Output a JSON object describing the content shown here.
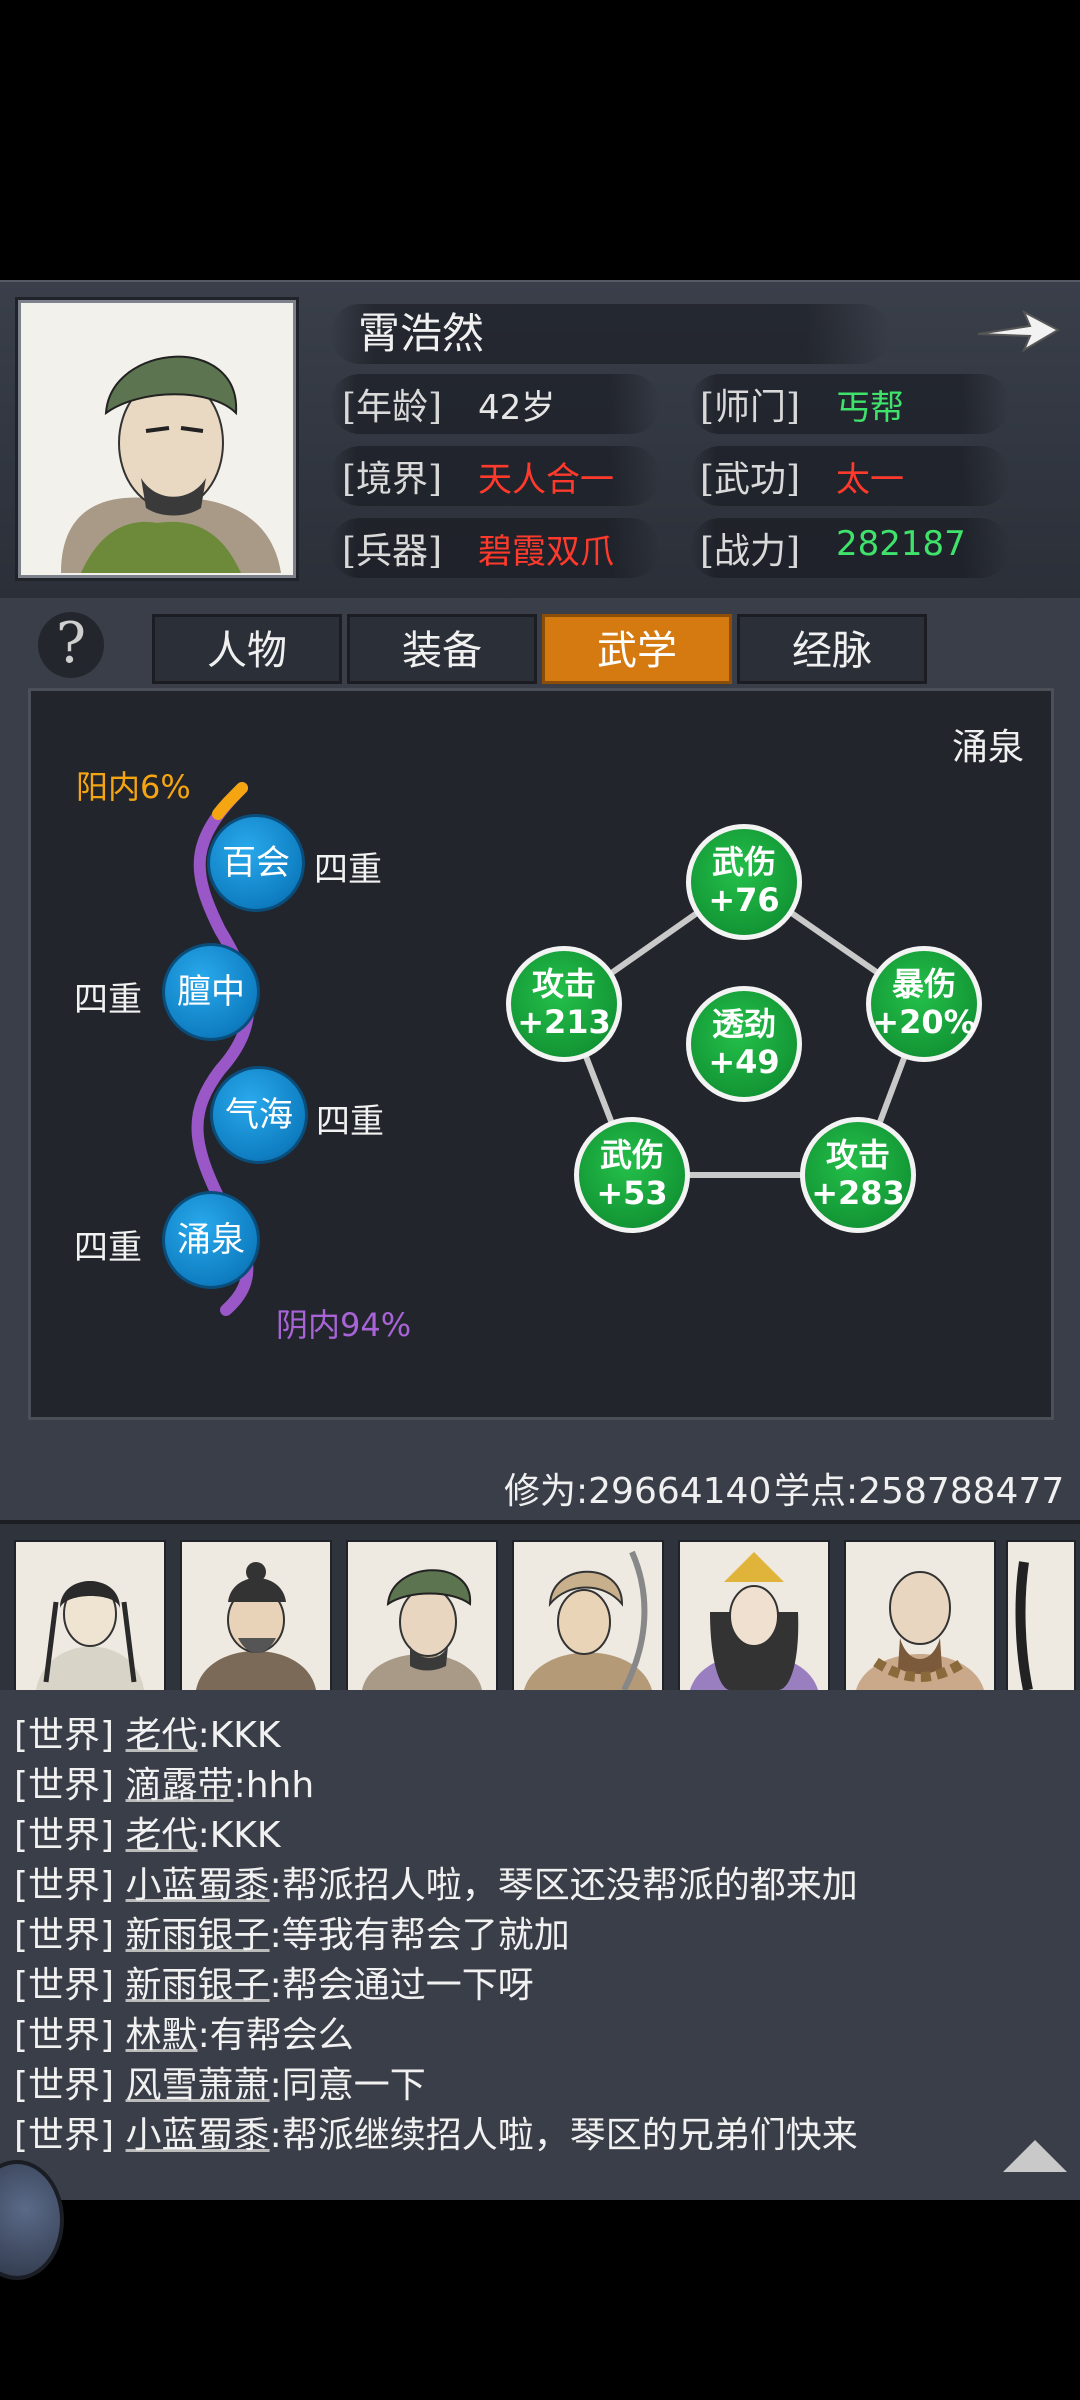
{
  "profile": {
    "name": "霄浩然",
    "stats": [
      {
        "label": "[年龄]",
        "value": "42岁",
        "color": "#e6e6e6"
      },
      {
        "label": "[师门]",
        "value": "丐帮",
        "color": "#3fe36b"
      },
      {
        "label": "[境界]",
        "value": "天人合一",
        "color": "#ff3a2c"
      },
      {
        "label": "[武功]",
        "value": "太一",
        "color": "#ff3a2c"
      },
      {
        "label": "[兵器]",
        "value": "碧霞双爪",
        "color": "#ff3a2c"
      },
      {
        "label": "[战力]",
        "value": "282187",
        "color": "#3fe36b"
      }
    ]
  },
  "tabs": [
    "人物",
    "装备",
    "武学",
    "经脉"
  ],
  "active_tab": "武学",
  "help_label": "?",
  "meridian": {
    "selected": "涌泉",
    "yang_label": "阳内6%",
    "yin_label": "阴内94%",
    "acupoints": [
      {
        "name": "百会",
        "level": "四重"
      },
      {
        "name": "膻中",
        "level": "四重"
      },
      {
        "name": "气海",
        "level": "四重"
      },
      {
        "name": "涌泉",
        "level": "四重"
      }
    ],
    "bonuses": [
      {
        "name": "武伤",
        "value": "+76"
      },
      {
        "name": "暴伤",
        "value": "+20%"
      },
      {
        "name": "攻击",
        "value": "+283"
      },
      {
        "name": "武伤",
        "value": "+53"
      },
      {
        "name": "攻击",
        "value": "+213"
      },
      {
        "name": "透劲",
        "value": "+49"
      }
    ]
  },
  "progress": {
    "cultivation": "修为:29664140",
    "points": "学点:258788477"
  },
  "chat": [
    {
      "channel": "[世界]",
      "name": "老代",
      "msg": ":KKK"
    },
    {
      "channel": "[世界]",
      "name": "滴露带",
      "msg": ":hhh"
    },
    {
      "channel": "[世界]",
      "name": "老代",
      "msg": ":KKK"
    },
    {
      "channel": "[世界]",
      "name": "小蓝蜀黍",
      "msg": ":帮派招人啦，琴区还没帮派的都来加"
    },
    {
      "channel": "[世界]",
      "name": "新雨银子",
      "msg": ":等我有帮会了就加"
    },
    {
      "channel": "[世界]",
      "name": "新雨银子",
      "msg": ":帮会通过一下呀"
    },
    {
      "channel": "[世界]",
      "name": "林默",
      "msg": ":有帮会么"
    },
    {
      "channel": "[世界]",
      "name": "风雪萧萧",
      "msg": ":同意一下"
    },
    {
      "channel": "[世界]",
      "name": "小蓝蜀黍",
      "msg": ":帮派继续招人啦，琴区的兄弟们快来"
    }
  ]
}
